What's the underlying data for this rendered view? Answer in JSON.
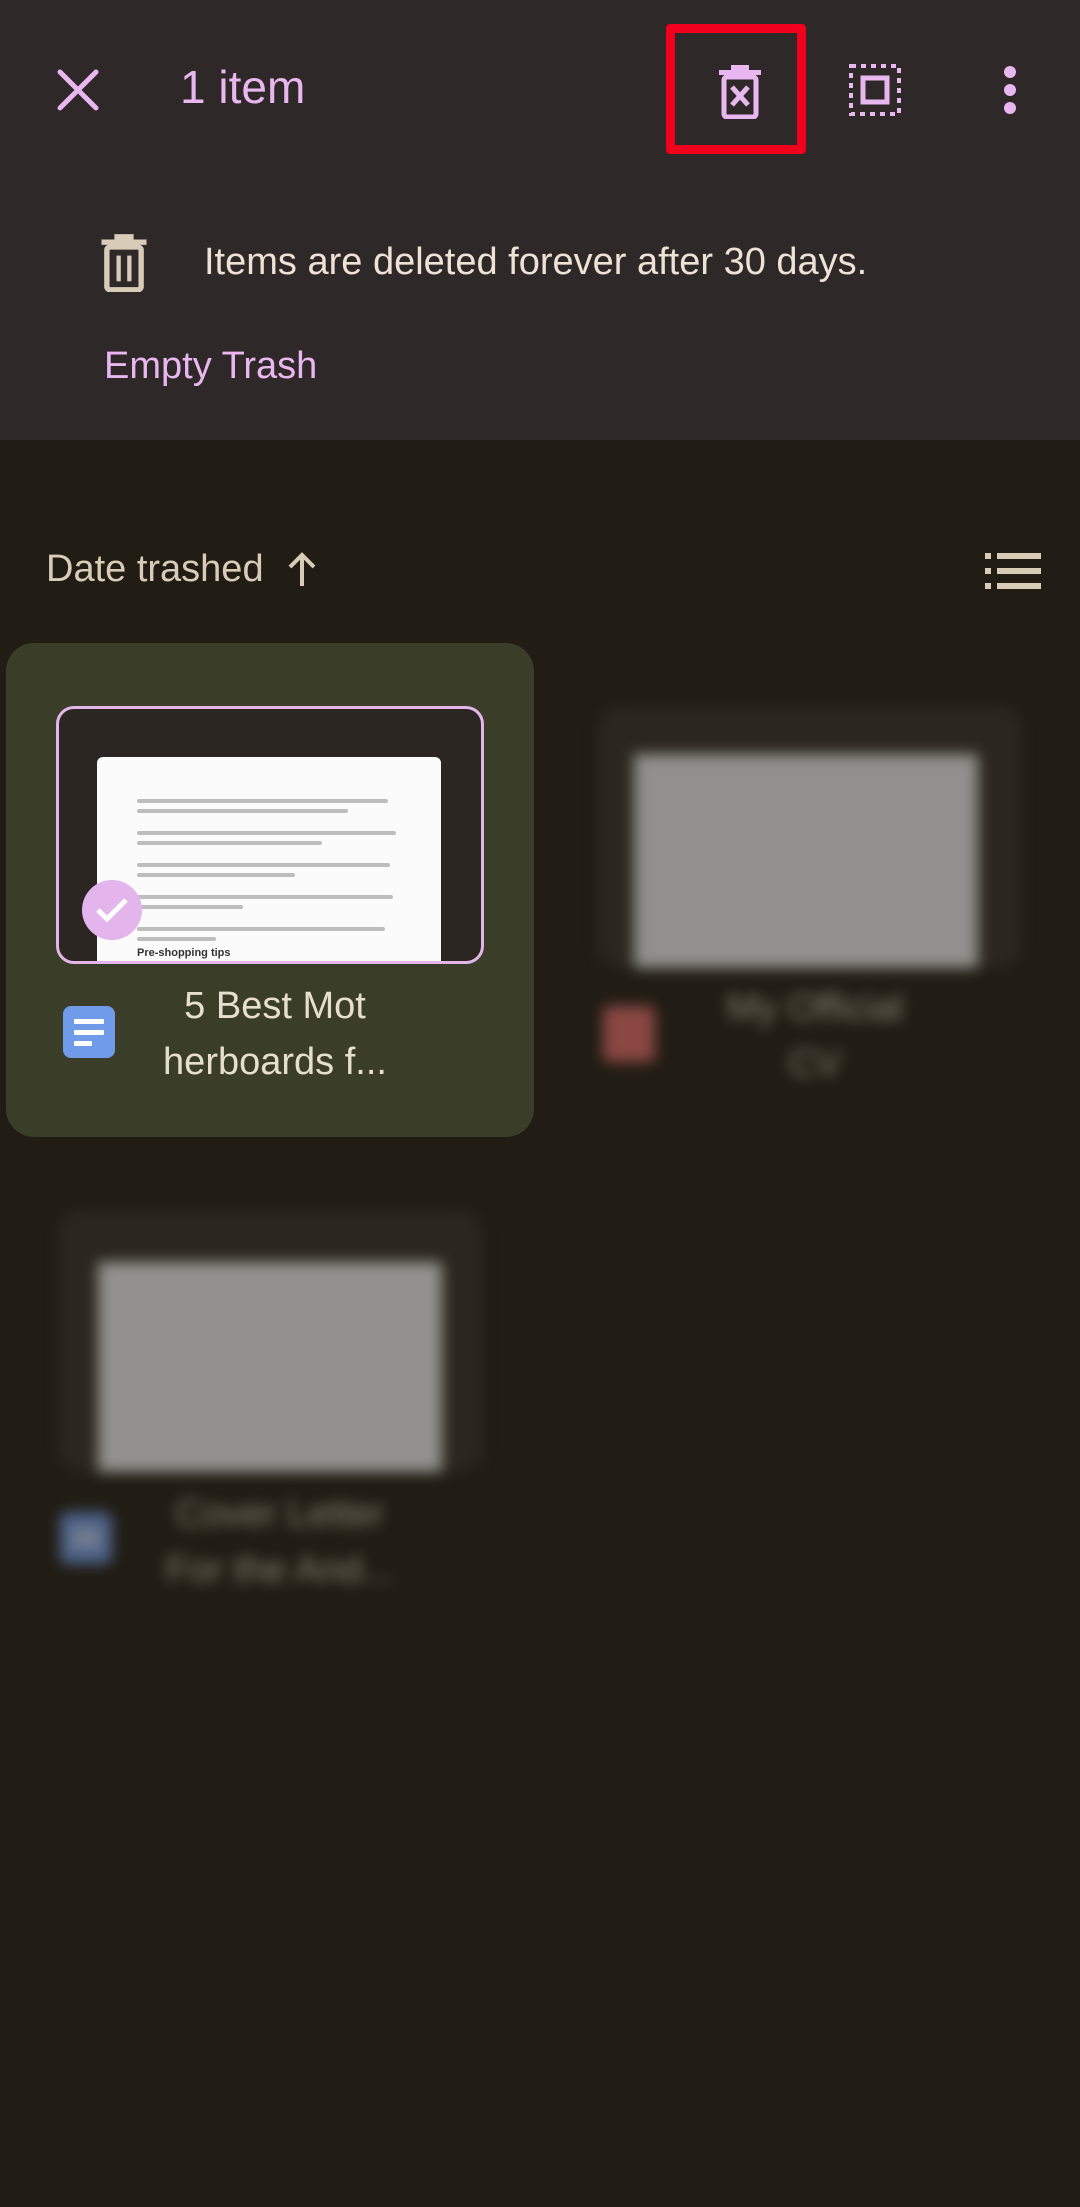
{
  "topbar": {
    "title": "1 item",
    "close_icon": "close-icon",
    "delete_forever_icon": "delete-forever-icon",
    "select_all_icon": "select-all-icon",
    "more_icon": "more-vert-icon",
    "highlight_color": "#f0001c"
  },
  "notice": {
    "icon": "trash-icon",
    "text": "Items are deleted forever after 30 days.",
    "action": "Empty Trash"
  },
  "sort": {
    "label": "Date trashed",
    "direction_icon": "arrow-up-icon",
    "view_icon": "list-view-icon"
  },
  "files": [
    {
      "title_line1": "5 Best Mot",
      "title_line2": "herboards f...",
      "type_icon": "google-docs-icon",
      "selected": true,
      "preview_heading": "Pre-shopping tips"
    },
    {
      "title_line1": "My Official",
      "title_line2": "CV",
      "type_icon": "pdf-icon",
      "selected": false
    },
    {
      "title_line1": "Cover Letter",
      "title_line2": "For the And...",
      "type_icon": "google-docs-icon",
      "selected": false
    }
  ],
  "colors": {
    "accent": "#e9b7ef",
    "topbar_bg": "#2f2828",
    "page_bg": "#211d14",
    "selected_card_bg": "#3a3d28"
  }
}
